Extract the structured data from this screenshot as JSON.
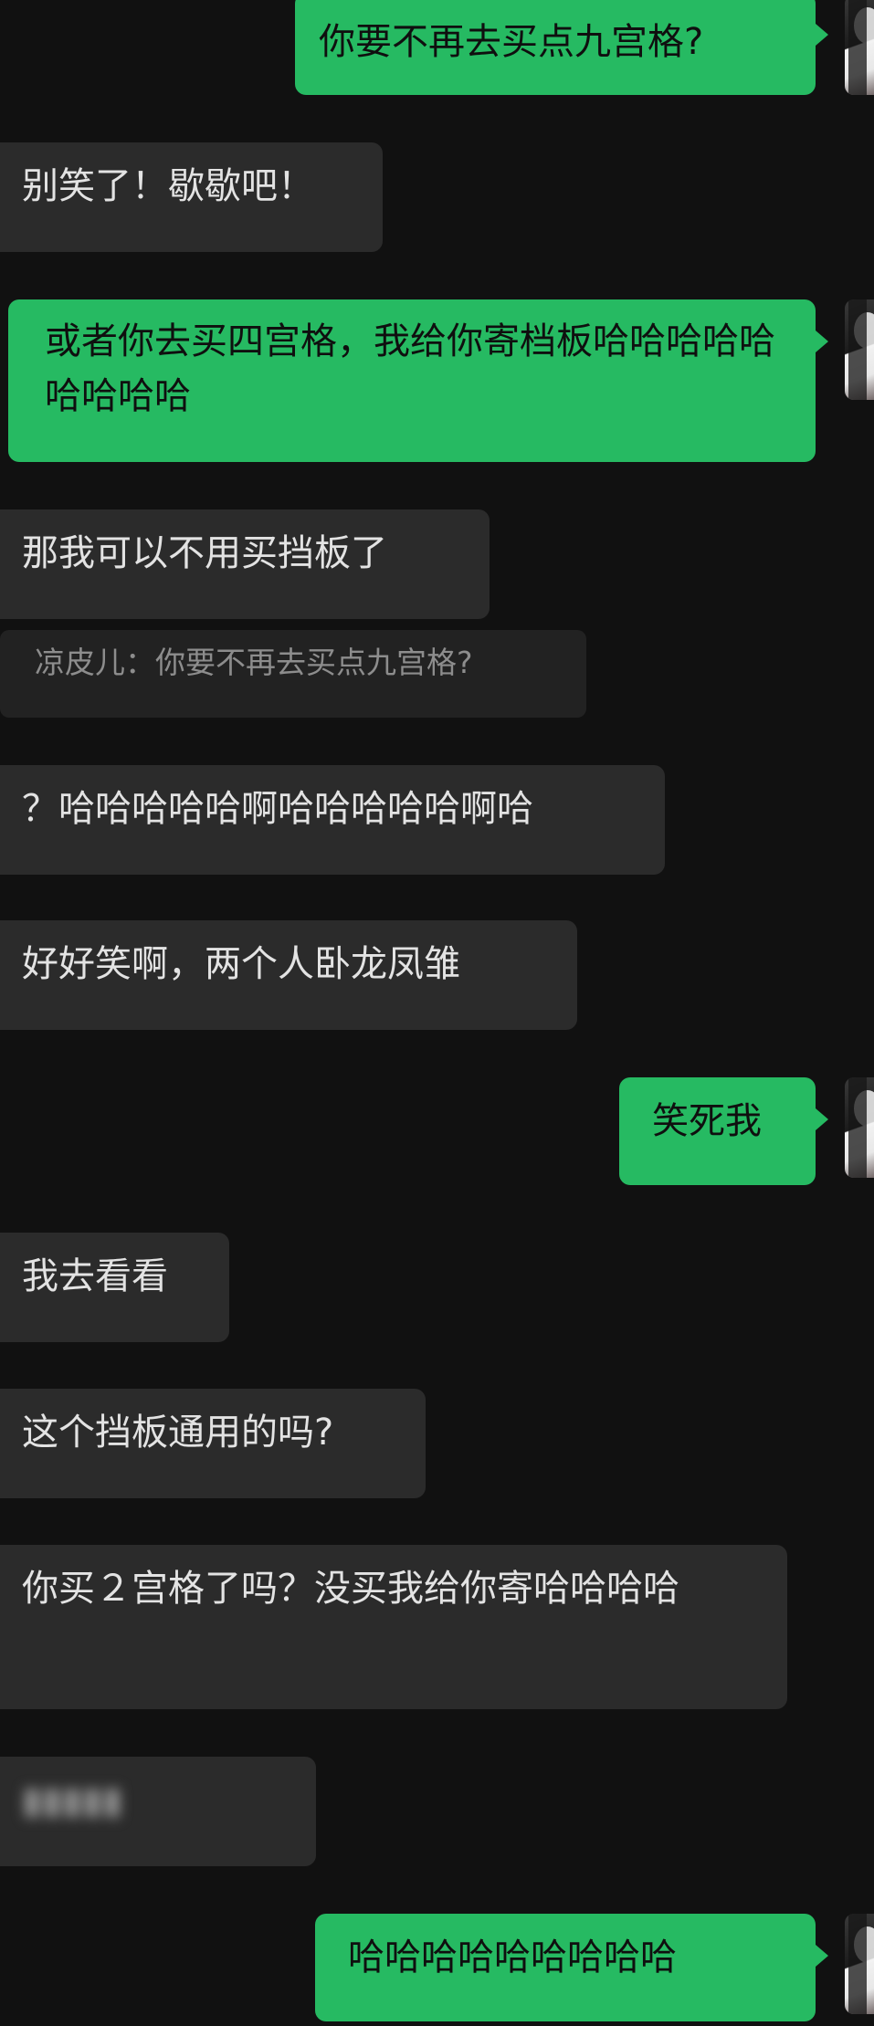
{
  "messages": [
    {
      "text": "你要不再去买点九宫格?"
    },
    {
      "text": "别笑了！歇歇吧！"
    },
    {
      "text": "或者你去买四宫格，我给你寄档板哈哈哈哈哈哈哈哈哈"
    },
    {
      "text": "那我可以不用买挡板了"
    },
    {
      "text": "凉皮儿：你要不再去买点九宫格?"
    },
    {
      "text": "？哈哈哈哈哈啊哈哈哈哈哈啊哈"
    },
    {
      "text": "好好笑啊，两个人卧龙凤雏"
    },
    {
      "text": "笑死我"
    },
    {
      "text": "我去看看"
    },
    {
      "text": "这个挡板通用的吗?"
    },
    {
      "text": "你买２宫格了吗？没买我给你寄哈哈哈哈"
    },
    {
      "text": "哈哈哈哈哈哈哈哈哈"
    }
  ]
}
